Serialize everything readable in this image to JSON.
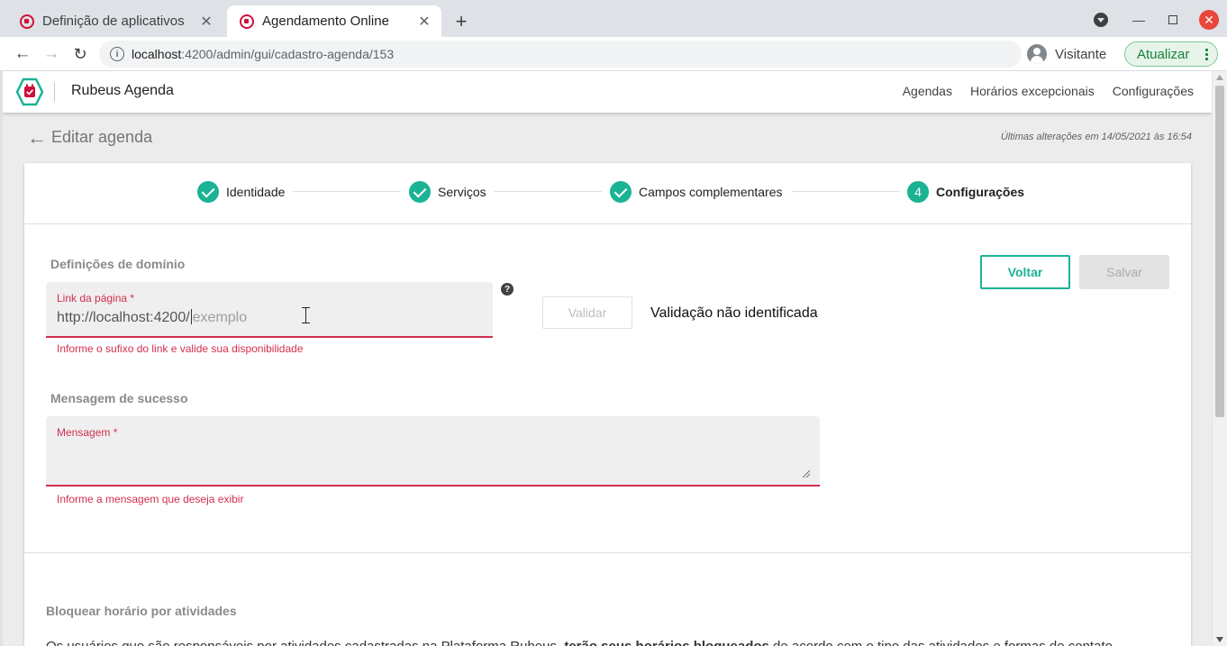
{
  "browser": {
    "tabs": [
      {
        "title": "Definição de aplicativos",
        "active": false
      },
      {
        "title": "Agendamento Online",
        "active": true
      }
    ],
    "url_host": "localhost",
    "url_path": ":4200/admin/gui/cadastro-agenda/153",
    "profile_label": "Visitante",
    "update_label": "Atualizar"
  },
  "app": {
    "brand": "Rubeus Agenda",
    "brand_color": "#d0103a",
    "accent": "#1ab394",
    "nav": [
      "Agendas",
      "Horários excepcionais",
      "Configurações"
    ]
  },
  "header": {
    "title": "Editar agenda",
    "last_change": "Últimas alterações em 14/05/2021 às 16:54"
  },
  "stepper": {
    "steps": [
      {
        "label": "Identidade",
        "state": "done"
      },
      {
        "label": "Serviços",
        "state": "done"
      },
      {
        "label": "Campos complementares",
        "state": "done"
      },
      {
        "label": "Configurações",
        "state": "current",
        "number": "4"
      }
    ]
  },
  "form": {
    "domain_section": "Definições de domínio",
    "link_label": "Link da página *",
    "link_prefix": "http://localhost:4200/",
    "link_placeholder": "exemplo",
    "link_hint": "Informe o sufixo do link e valide sua disponibilidade",
    "validate_label": "Validar",
    "validation_status": "Validação não identificada",
    "success_section": "Mensagem de sucesso",
    "message_label": "Mensagem *",
    "message_value": "",
    "message_hint": "Informe a mensagem que deseja exibir",
    "back_label": "Voltar",
    "save_label": "Salvar",
    "block_section": "Bloquear horário por atividades",
    "block_text_start": "Os usuários que são responsáveis por atividades cadastradas na Plataforma Rubeus, ",
    "block_text_bold": "terão seus horários bloqueados",
    "block_text_end": " de acordo com o tipo das atividades e formas de contato"
  }
}
